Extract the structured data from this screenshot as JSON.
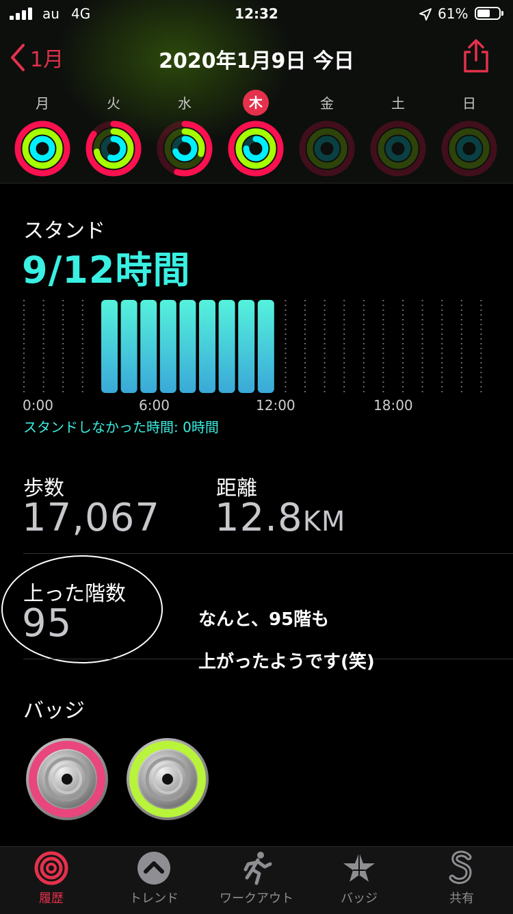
{
  "status_bar": {
    "carrier": "au",
    "network": "4G",
    "time": "12:32",
    "battery": "61%",
    "battery_level": 0.61
  },
  "nav": {
    "back_label": "1月",
    "title": "2020年1月9日 今日"
  },
  "week": {
    "days": [
      {
        "label": "月",
        "today": false
      },
      {
        "label": "火",
        "today": false
      },
      {
        "label": "水",
        "today": false
      },
      {
        "label": "木",
        "today": true
      },
      {
        "label": "金",
        "today": false
      },
      {
        "label": "土",
        "today": false
      },
      {
        "label": "日",
        "today": false
      }
    ],
    "ring_progress": [
      {
        "move": 1.0,
        "exercise": 1.0,
        "stand": 1.0
      },
      {
        "move": 0.85,
        "exercise": 0.72,
        "stand": 0.55
      },
      {
        "move": 0.55,
        "exercise": 0.3,
        "stand": 0.7
      },
      {
        "move": 1.0,
        "exercise": 1.0,
        "stand": 0.75
      },
      {
        "move": 0,
        "exercise": 0,
        "stand": 0
      },
      {
        "move": 0,
        "exercise": 0,
        "stand": 0
      },
      {
        "move": 0,
        "exercise": 0,
        "stand": 0
      }
    ]
  },
  "stand": {
    "label": "スタンド",
    "value": "9/12時間",
    "no_stand_text": "スタンドしなかった時間: 0時間",
    "axis_labels": [
      "0:00",
      "6:00",
      "12:00",
      "18:00"
    ]
  },
  "chart_data": {
    "type": "bar",
    "title": "スタンド",
    "categories": [
      "0",
      "1",
      "2",
      "3",
      "4",
      "5",
      "6",
      "7",
      "8",
      "9",
      "10",
      "11",
      "12",
      "13",
      "14",
      "15",
      "16",
      "17",
      "18",
      "19",
      "20",
      "21",
      "22",
      "23"
    ],
    "values": [
      0,
      0,
      0,
      0,
      1,
      1,
      1,
      1,
      1,
      1,
      1,
      1,
      1,
      0,
      0,
      0,
      0,
      0,
      0,
      0,
      0,
      0,
      0,
      0
    ],
    "xticks": [
      "0:00",
      "6:00",
      "12:00",
      "18:00"
    ],
    "ylim": [
      0,
      1
    ]
  },
  "metrics": {
    "steps_label": "歩数",
    "steps_value": "17,067",
    "distance_label": "距離",
    "distance_value": "12.8",
    "distance_unit": "KM",
    "floors_label": "上った階数",
    "floors_value": "95"
  },
  "annotation": {
    "line1": "なんと、95階も",
    "line2": "上がったようです(笑)"
  },
  "badges": {
    "label": "バッジ",
    "items": [
      {
        "color": "#e8467c"
      },
      {
        "color": "#b8f43a"
      }
    ]
  },
  "tabs": [
    {
      "label": "履歴",
      "active": true,
      "icon": "rings-icon"
    },
    {
      "label": "トレンド",
      "active": false,
      "icon": "trend-icon"
    },
    {
      "label": "ワークアウト",
      "active": false,
      "icon": "running-icon"
    },
    {
      "label": "バッジ",
      "active": false,
      "icon": "star-badge-icon"
    },
    {
      "label": "共有",
      "active": false,
      "icon": "share-s-icon"
    }
  ],
  "colors": {
    "accent": "#e5314c",
    "move": "#fa114f",
    "exercise": "#a6ff00",
    "stand": "#00f0ff",
    "stand_text": "#3af0e2"
  }
}
